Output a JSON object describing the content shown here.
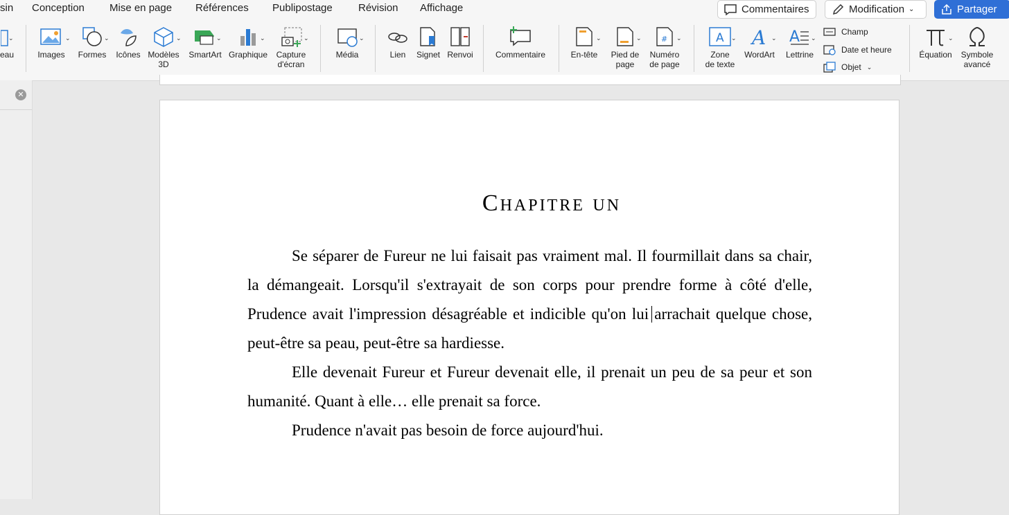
{
  "tabs": [
    "sin",
    "Conception",
    "Mise en page",
    "Références",
    "Publipostage",
    "Révision",
    "Affichage"
  ],
  "top_buttons": {
    "comments": "Commentaires",
    "editing": "Modification",
    "share": "Partager"
  },
  "ribbon": {
    "tableau_label": "eau",
    "images": "Images",
    "formes": "Formes",
    "icones": "Icônes",
    "modeles3d": "Modèles\n3D",
    "smartart": "SmartArt",
    "graphique": "Graphique",
    "capture": "Capture\nd'écran",
    "media": "Média",
    "lien": "Lien",
    "signet": "Signet",
    "renvoi": "Renvoi",
    "commentaire": "Commentaire",
    "entete": "En-tête",
    "pied": "Pied de\npage",
    "numero": "Numéro\nde page",
    "zone": "Zone\nde texte",
    "wordart": "WordArt",
    "lettrine": "Lettrine",
    "champ": "Champ",
    "date": "Date et heure",
    "objet": "Objet",
    "equation": "Équation",
    "symbole": "Symbole\navancé"
  },
  "document": {
    "chapter_title": "Chapitre un",
    "paragraphs": [
      "Se séparer de Fureur ne lui faisait pas vraiment mal. Il fourmillait dans sa chair, la démangeait. Lorsqu'il s'extrayait de son corps pour prendre forme à côté d'elle, Prudence avait l'impression désagréable et indicible qu'on lui arrachait quelque chose, peut-être sa peau, peut-être sa hardiesse.",
      "Elle devenait Fureur et Fureur devenait elle, il prenait un peu de sa peur et son humanité. Quant à elle… elle prenait sa force.",
      "Prudence n'avait pas besoin de force aujourd'hui."
    ]
  },
  "colors": {
    "accent": "#2f6fd6",
    "icon_blue": "#2b7bd3",
    "icon_green": "#3aa757"
  }
}
